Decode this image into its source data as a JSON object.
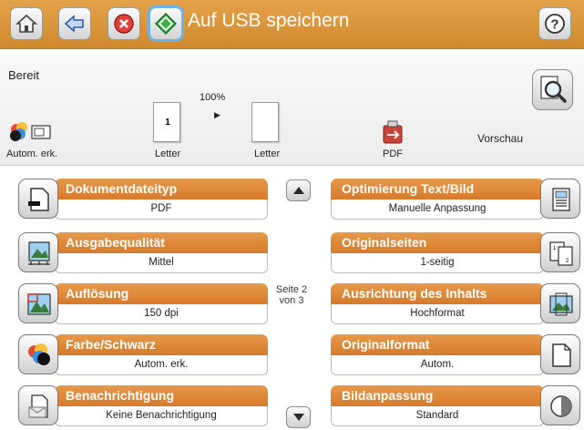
{
  "header": {
    "title": "Auf USB speichern"
  },
  "status": {
    "text": "Bereit",
    "zoom": "100%"
  },
  "preview": {
    "color_label": "Autom. erk.",
    "page1_number": "1",
    "page1_label": "Letter",
    "page2_label": "Letter",
    "format_label": "PDF",
    "preview_label": "Vorschau"
  },
  "settings_left": [
    {
      "title": "Dokumentdateityp",
      "value": "PDF",
      "icon": "document-type-icon"
    },
    {
      "title": "Ausgabequalität",
      "value": "Mittel",
      "icon": "output-quality-icon"
    },
    {
      "title": "Auflösung",
      "value": "150 dpi",
      "icon": "resolution-icon"
    },
    {
      "title": "Farbe/Schwarz",
      "value": "Autom. erk.",
      "icon": "color-black-icon"
    },
    {
      "title": "Benachrichtigung",
      "value": "Keine Benachrichtigung",
      "icon": "notification-icon"
    }
  ],
  "settings_right": [
    {
      "title": "Optimierung Text/Bild",
      "value": "Manuelle Anpassung",
      "icon": "text-image-optimization-icon"
    },
    {
      "title": "Originalseiten",
      "value": "1-seitig",
      "icon": "original-sides-icon"
    },
    {
      "title": "Ausrichtung des Inhalts",
      "value": "Hochformat",
      "icon": "content-orientation-icon"
    },
    {
      "title": "Originalformat",
      "value": "Autom.",
      "icon": "original-size-icon"
    },
    {
      "title": "Bildanpassung",
      "value": "Standard",
      "icon": "image-adjustment-icon"
    }
  ],
  "pagination": {
    "line1": "Seite 2",
    "line2": "von 3"
  },
  "colors": {
    "topbar": "#d99438",
    "setting_header": "#de8a3a"
  }
}
